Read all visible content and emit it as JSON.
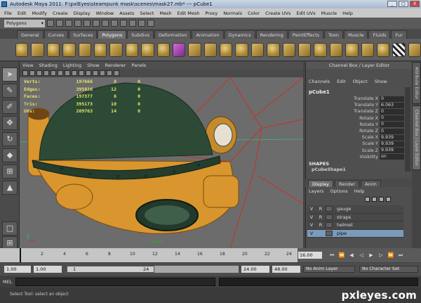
{
  "window": {
    "title": "Autodesk Maya 2011: F:\\pxlEyes\\steampunk mask\\scenes\\mask27.mb*  ---  pCube1",
    "controls": [
      "_",
      "□",
      "X"
    ]
  },
  "menubar": [
    "File",
    "Edit",
    "Modify",
    "Create",
    "Display",
    "Window",
    "Assets",
    "Select",
    "Mesh",
    "Edit Mesh",
    "Proxy",
    "Normals",
    "Color",
    "Create UVs",
    "Edit UVs",
    "Muscle",
    "Help"
  ],
  "status_line": {
    "mode": "Polygons"
  },
  "shelf_tabs": [
    {
      "label": "General",
      "active": false
    },
    {
      "label": "Curves",
      "active": false
    },
    {
      "label": "Surfaces",
      "active": false
    },
    {
      "label": "Polygons",
      "active": true
    },
    {
      "label": "Subdivs",
      "active": false
    },
    {
      "label": "Deformation",
      "active": false
    },
    {
      "label": "Animation",
      "active": false
    },
    {
      "label": "Dynamics",
      "active": false
    },
    {
      "label": "Rendering",
      "active": false
    },
    {
      "label": "PaintEffects",
      "active": false
    },
    {
      "label": "Toon",
      "active": false
    },
    {
      "label": "Muscle",
      "active": false
    },
    {
      "label": "Fluids",
      "active": false
    },
    {
      "label": "Fur",
      "active": false
    }
  ],
  "shelf_icons": [
    "poly-sphere-icon",
    "poly-cube-icon",
    "poly-cylinder-icon",
    "poly-cone-icon",
    "poly-plane-icon",
    "poly-torus-icon",
    "poly-prism-icon",
    "poly-pyramid-icon",
    "poly-pipe-icon",
    "poly-helix-icon",
    "poly-soccer-icon",
    "poly-platonic-icon",
    "combine-icon",
    "separate-icon",
    "extract-icon",
    "smooth-icon",
    "boolean-icon",
    "average-icon",
    "fill-hole-icon",
    "append-icon",
    "split-icon",
    "insert-loop-icon",
    "offset-loop-icon",
    "extrude-icon",
    "bridge-icon",
    "bevel-icon",
    "merge-icon",
    "collapse-icon",
    "checker-icon",
    "uv-editor-icon"
  ],
  "panel_menu": [
    "View",
    "Shading",
    "Lighting",
    "Show",
    "Renderer",
    "Panels"
  ],
  "hud": {
    "rows": [
      {
        "label": "Verts:",
        "v1": "197666",
        "v2": "8",
        "v3": "0"
      },
      {
        "label": "Edges:",
        "v1": "395826",
        "v2": "12",
        "v3": "0"
      },
      {
        "label": "Faces:",
        "v1": "197377",
        "v2": "6",
        "v3": "0"
      },
      {
        "label": "Tris:",
        "v1": "395173",
        "v2": "10",
        "v3": "0"
      },
      {
        "label": "UVs:",
        "v1": "209763",
        "v2": "14",
        "v3": "0"
      }
    ],
    "camera": "persp"
  },
  "channel_box": {
    "header": "Channel Box / Layer Editor",
    "menu": [
      "Channels",
      "Edit",
      "Object",
      "Show"
    ],
    "object": "pCube1",
    "attributes": [
      {
        "name": "Translate X",
        "value": "0"
      },
      {
        "name": "Translate Y",
        "value": "6.063"
      },
      {
        "name": "Translate Z",
        "value": "0"
      },
      {
        "name": "Rotate X",
        "value": "0"
      },
      {
        "name": "Rotate Y",
        "value": "0"
      },
      {
        "name": "Rotate Z",
        "value": "0"
      },
      {
        "name": "Scale X",
        "value": "9.939"
      },
      {
        "name": "Scale Y",
        "value": "9.939"
      },
      {
        "name": "Scale Z",
        "value": "9.939"
      },
      {
        "name": "Visibility",
        "value": "on"
      }
    ],
    "shapes_label": "SHAPES",
    "shape_name": "pCubeShape1"
  },
  "side_tabs": [
    "Attribute Editor",
    "Channel Box / Layer Editor"
  ],
  "layer_editor": {
    "tabs": [
      {
        "label": "Display",
        "active": true
      },
      {
        "label": "Render",
        "active": false
      },
      {
        "label": "Anim",
        "active": false
      }
    ],
    "menu": [
      "Layers",
      "Options",
      "Help"
    ],
    "layers": [
      {
        "v": "V",
        "r": "R",
        "name": "gauge",
        "selected": false
      },
      {
        "v": "V",
        "r": "R",
        "name": "straps",
        "selected": false
      },
      {
        "v": "V",
        "r": "R",
        "name": "helmet",
        "selected": false
      },
      {
        "v": "V",
        "r": "",
        "name": "pipe",
        "selected": true
      }
    ]
  },
  "timeline": {
    "ticks": [
      "2",
      "4",
      "6",
      "8",
      "10",
      "12",
      "14",
      "16",
      "18",
      "20",
      "22",
      "24"
    ],
    "current_frame": "16.00"
  },
  "range": {
    "start": "1.00",
    "start2": "1.00",
    "bar_start": "1",
    "bar_end": "24",
    "end": "24.00",
    "end2": "48.00",
    "anim_layer": "No Anim Layer",
    "char_set": "No Character Set"
  },
  "cmd": {
    "label": "MEL"
  },
  "help_line": "Select Tool: select an object",
  "watermark": "pxleyes.com",
  "colors": {
    "helmet": "#2c4a35",
    "brass": "#d9962e",
    "viewport": "#6c6c6c",
    "wire": "#c8312a"
  }
}
